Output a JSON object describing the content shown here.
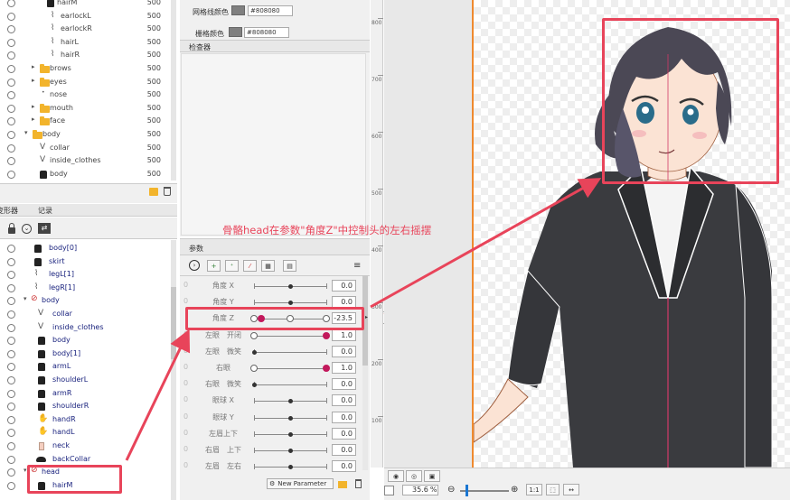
{
  "parts_top": [
    {
      "label": "hairM",
      "value": "500",
      "kind": "partdark",
      "indent": 52
    },
    {
      "label": "earlockL",
      "value": "500",
      "kind": "strand",
      "indent": 56
    },
    {
      "label": "earlockR",
      "value": "500",
      "kind": "strand",
      "indent": 56
    },
    {
      "label": "hairL",
      "value": "500",
      "kind": "strand",
      "indent": 56
    },
    {
      "label": "hairR",
      "value": "500",
      "kind": "strand",
      "indent": 56
    },
    {
      "label": "brows",
      "value": "500",
      "kind": "folder",
      "indent": 44
    },
    {
      "label": "eyes",
      "value": "500",
      "kind": "folder",
      "indent": 44
    },
    {
      "label": "nose",
      "value": "500",
      "kind": "dot",
      "indent": 44
    },
    {
      "label": "mouth",
      "value": "500",
      "kind": "folder",
      "indent": 44
    },
    {
      "label": "face",
      "value": "500",
      "kind": "folder",
      "indent": 44
    },
    {
      "label": "body",
      "value": "500",
      "kind": "folder-open",
      "indent": 36
    },
    {
      "label": "collar",
      "value": "500",
      "kind": "vshape",
      "indent": 44
    },
    {
      "label": "inside_clothes",
      "value": "500",
      "kind": "vshape",
      "indent": 44
    },
    {
      "label": "body",
      "value": "500",
      "kind": "partdark",
      "indent": 44
    }
  ],
  "deformer_panel": {
    "tab_deformer": "变形器",
    "tab_log": "记录"
  },
  "deformer_items": [
    {
      "label": "body[0]",
      "kind": "part",
      "indent": 44
    },
    {
      "label": "skirt",
      "kind": "part",
      "indent": 44
    },
    {
      "label": "legL[1]",
      "kind": "strand",
      "indent": 44
    },
    {
      "label": "legR[1]",
      "kind": "strand",
      "indent": 44
    },
    {
      "label": "body",
      "kind": "bone-open",
      "indent": 36
    },
    {
      "label": "collar",
      "kind": "vshape",
      "indent": 48
    },
    {
      "label": "inside_clothes",
      "kind": "vshape",
      "indent": 48
    },
    {
      "label": "body",
      "kind": "part",
      "indent": 48
    },
    {
      "label": "body[1]",
      "kind": "part",
      "indent": 48
    },
    {
      "label": "armL",
      "kind": "part",
      "indent": 48
    },
    {
      "label": "shoulderL",
      "kind": "part",
      "indent": 48
    },
    {
      "label": "armR",
      "kind": "part",
      "indent": 48
    },
    {
      "label": "shoulderR",
      "kind": "part",
      "indent": 48
    },
    {
      "label": "handR",
      "kind": "hand",
      "indent": 48
    },
    {
      "label": "handL",
      "kind": "hand",
      "indent": 48
    },
    {
      "label": "neck",
      "kind": "neck",
      "indent": 48
    },
    {
      "label": "backCollar",
      "kind": "collarshape",
      "indent": 48
    },
    {
      "label": "head",
      "kind": "bone-open",
      "indent": 36
    },
    {
      "label": "hairM",
      "kind": "partdark",
      "indent": 48
    }
  ],
  "inspector": {
    "grid_color_label_1": "网格线颜色",
    "grid_color_value_1": "#808080",
    "grid_color_label_2": "栅格颜色",
    "grid_color_value_2": "#808080",
    "tab_inspector": "检查器"
  },
  "params": {
    "tab_label": "参数",
    "new_parameter_label": "New Parameter",
    "rows": [
      {
        "zero": "0",
        "name": "角度 X",
        "value": "0.0",
        "dot": 0.5,
        "style": "center"
      },
      {
        "zero": "0",
        "name": "角度 Y",
        "value": "0.0",
        "dot": 0.5,
        "style": "center"
      },
      {
        "zero": "",
        "name": "角度 Z",
        "value": "-23.5",
        "dot": 0.1,
        "style": "keys3",
        "highlight": true
      },
      {
        "zero": "0",
        "name": "左眼　开闭",
        "value": "1.0",
        "dot": 1.0,
        "style": "eye"
      },
      {
        "zero": "0",
        "name": "左眼　微笑",
        "value": "0.0",
        "dot": 0.0,
        "style": "left"
      },
      {
        "zero": "0",
        "name": "右眼",
        "value": "1.0",
        "dot": 1.0,
        "style": "eye"
      },
      {
        "zero": "0",
        "name": "右眼　微笑",
        "value": "0.0",
        "dot": 0.0,
        "style": "left"
      },
      {
        "zero": "0",
        "name": "眼球 X",
        "value": "0.0",
        "dot": 0.5,
        "style": "center"
      },
      {
        "zero": "0",
        "name": "眼球 Y",
        "value": "0.0",
        "dot": 0.5,
        "style": "center"
      },
      {
        "zero": "0",
        "name": "左眉上下",
        "value": "0.0",
        "dot": 0.5,
        "style": "center"
      },
      {
        "zero": "0",
        "name": "右眉　上下",
        "value": "0.0",
        "dot": 0.5,
        "style": "center"
      },
      {
        "zero": "0",
        "name": "左眉　左右",
        "value": "0.0",
        "dot": 0.5,
        "style": "center"
      }
    ]
  },
  "ruler": [
    "800",
    "700",
    "600",
    "500",
    "400",
    "300",
    "200",
    "100"
  ],
  "viewer": {
    "zoom": "35.6",
    "zoom_unit": "%",
    "one_to_one": "1:1"
  },
  "annotation": {
    "text": "骨骼head在参数\"角度Z\"中控制头的左右摇摆",
    "color": "#e8445a"
  }
}
